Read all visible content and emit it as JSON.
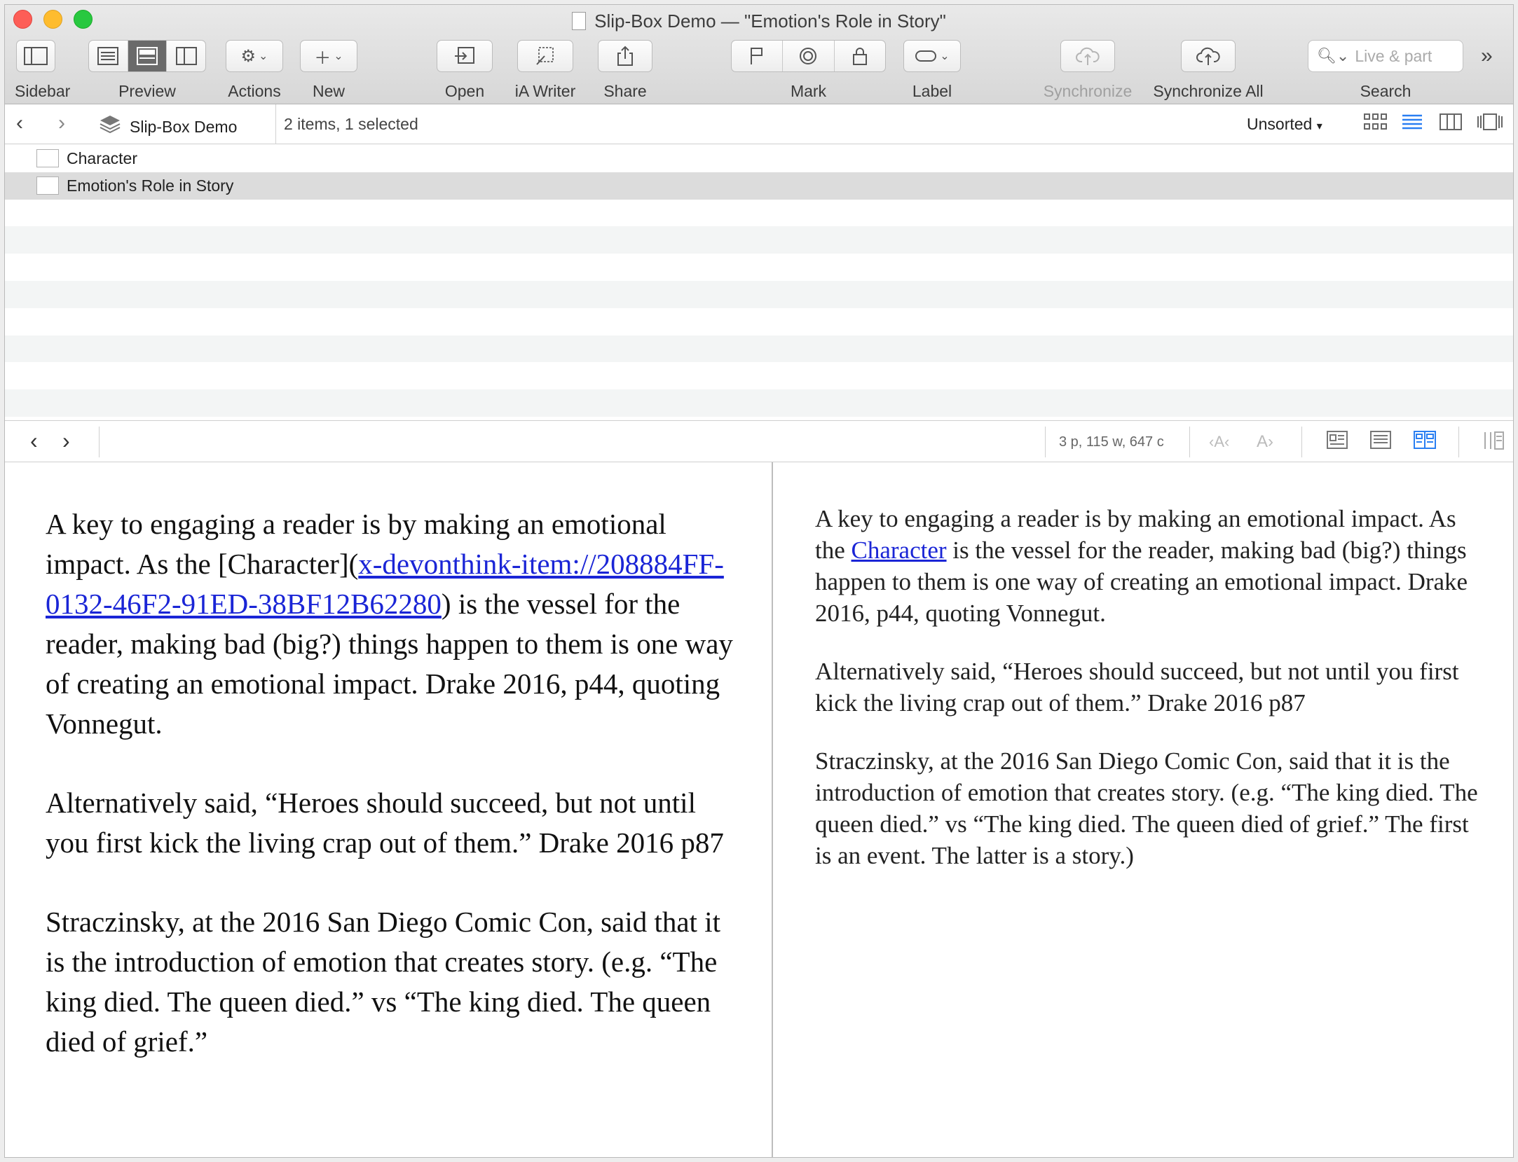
{
  "window": {
    "title": "Slip-Box Demo — \"Emotion's Role in Story\""
  },
  "toolbar": {
    "sidebar": "Sidebar",
    "preview": "Preview",
    "actions": "Actions",
    "new": "New",
    "open": "Open",
    "ia_writer": "iA Writer",
    "share": "Share",
    "mark": "Mark",
    "label": "Label",
    "synchronize": "Synchronize",
    "synchronize_all": "Synchronize All",
    "search": "Search",
    "search_placeholder": "Live & part"
  },
  "pathbar": {
    "database": "Slip-Box Demo",
    "count": "2 items, 1 selected",
    "sort": "Unsorted"
  },
  "list": {
    "items": [
      {
        "label": "Character"
      },
      {
        "label": "Emotion's Role in Story"
      }
    ],
    "selected_index": 1
  },
  "editor": {
    "stats": "3 p, 115 w, 647 c"
  },
  "source": {
    "p1_a": "A key to engaging a reader is by making an emotional impact. As the [Character](",
    "p1_link": "x-devonthink-item://208884FF-0132-46F2-91ED-38BF12B62280",
    "p1_b": ") is the vessel for the reader, making bad (big?) things happen to them is one way of creating an emotional impact. Drake 2016, p44, quoting Vonnegut.",
    "p2": "Alternatively said, “Heroes should succeed, but not until you first kick the living crap out of them.” Drake 2016 p87",
    "p3": "Straczinsky, at the 2016 San Diego Comic Con, said that it is the introduction of emotion that creates story. (e.g. “The king died. The queen died.” vs “The king died. The queen died of grief.”"
  },
  "preview": {
    "p1_a": "A key to engaging a reader is by making an emotional impact. As the ",
    "p1_link": "Character",
    "p1_b": " is the vessel for the reader, making bad (big?) things happen to them is one way of creating an emotional impact. Drake 2016, p44, quoting Vonnegut.",
    "p2": "Alternatively said, “Heroes should succeed, but not until you first kick the living crap out of them.” Drake 2016 p87",
    "p3": "Straczinsky, at the 2016 San Diego Comic Con, said that it is the introduction of emotion that creates story. (e.g. “The king died. The queen died.” vs “The king died. The queen died of grief.” The first is an event. The latter is a story.)"
  },
  "colors": {
    "link": "#1a25d6",
    "accent": "#2a7ff2",
    "selection": "#dcdcdc"
  }
}
